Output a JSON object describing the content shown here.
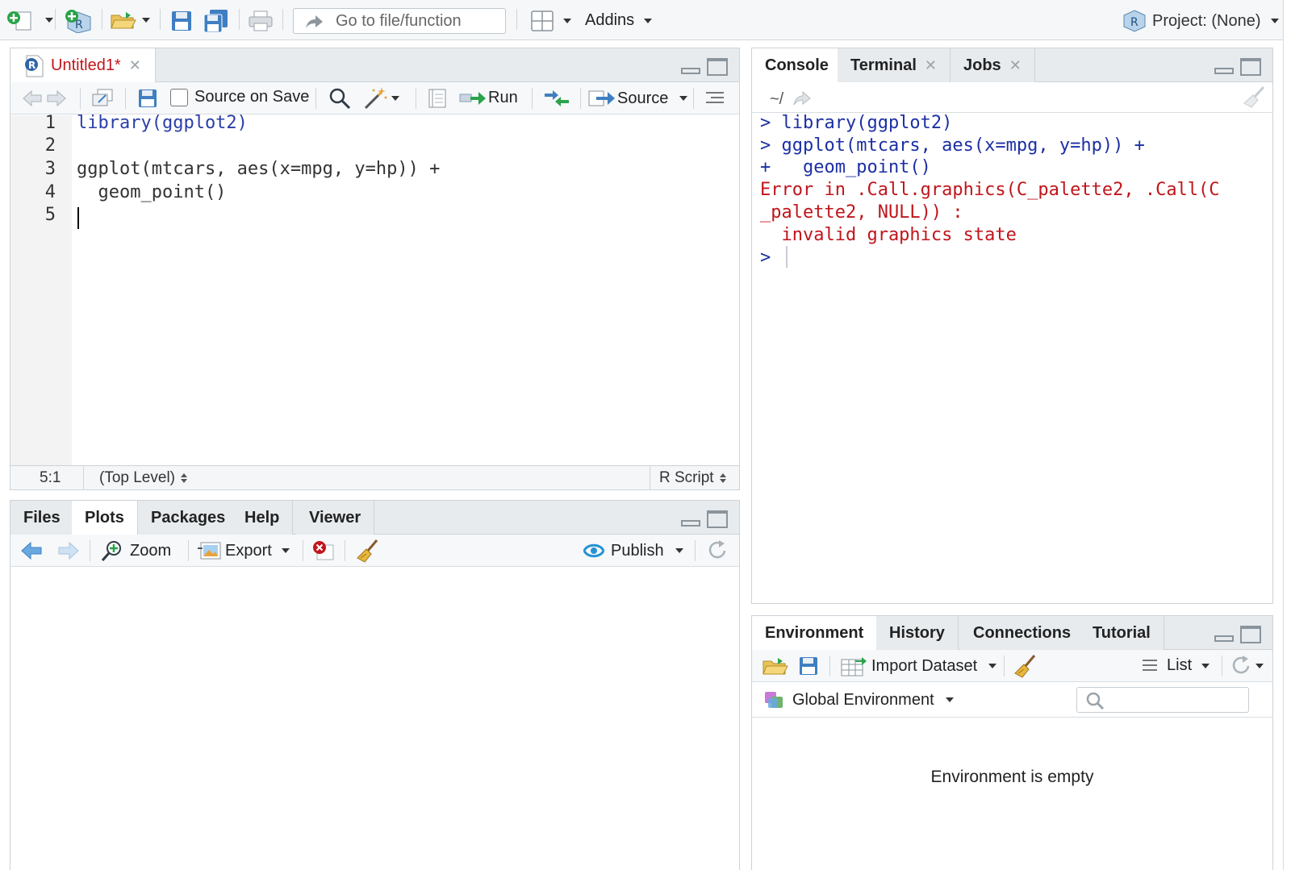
{
  "toolbar": {
    "goto_placeholder": "Go to file/function",
    "addins_label": "Addins",
    "project_label": "Project: (None)"
  },
  "source_pane": {
    "tab_title": "Untitled1*",
    "source_on_save_label": "Source on Save",
    "source_on_save_checked": false,
    "run_label": "Run",
    "source_label": "Source",
    "lines": [
      {
        "num": "1",
        "text": "library(ggplot2)"
      },
      {
        "num": "2",
        "text": ""
      },
      {
        "num": "3",
        "text": "ggplot(mtcars, aes(x=mpg, y=hp)) +"
      },
      {
        "num": "4",
        "text": "  geom_point()"
      },
      {
        "num": "5",
        "text": ""
      }
    ],
    "status": {
      "position": "5:1",
      "scope": "(Top Level)",
      "file_type": "R Script"
    }
  },
  "console_pane": {
    "tabs": [
      "Console",
      "Terminal",
      "Jobs"
    ],
    "path": "~/",
    "lines": [
      {
        "text": "> library(ggplot2)",
        "type": "input"
      },
      {
        "text": "> ggplot(mtcars, aes(x=mpg, y=hp)) +",
        "type": "input"
      },
      {
        "text": "+   geom_point()",
        "type": "input"
      },
      {
        "text": "Error in .Call.graphics(C_palette2, .Call(C",
        "type": "error"
      },
      {
        "text": "_palette2, NULL)) :",
        "type": "error"
      },
      {
        "text": "  invalid graphics state",
        "type": "error"
      },
      {
        "text": "> ",
        "type": "input"
      }
    ]
  },
  "plots_pane": {
    "tabs": [
      "Files",
      "Plots",
      "Packages",
      "Help",
      "Viewer"
    ],
    "active_tab": "Plots",
    "zoom_label": "Zoom",
    "export_label": "Export",
    "publish_label": "Publish"
  },
  "env_pane": {
    "tabs": [
      "Environment",
      "History",
      "Connections",
      "Tutorial"
    ],
    "active_tab": "Environment",
    "import_dataset_label": "Import Dataset",
    "list_label": "List",
    "global_env_label": "Global Environment",
    "empty_message": "Environment is empty"
  }
}
